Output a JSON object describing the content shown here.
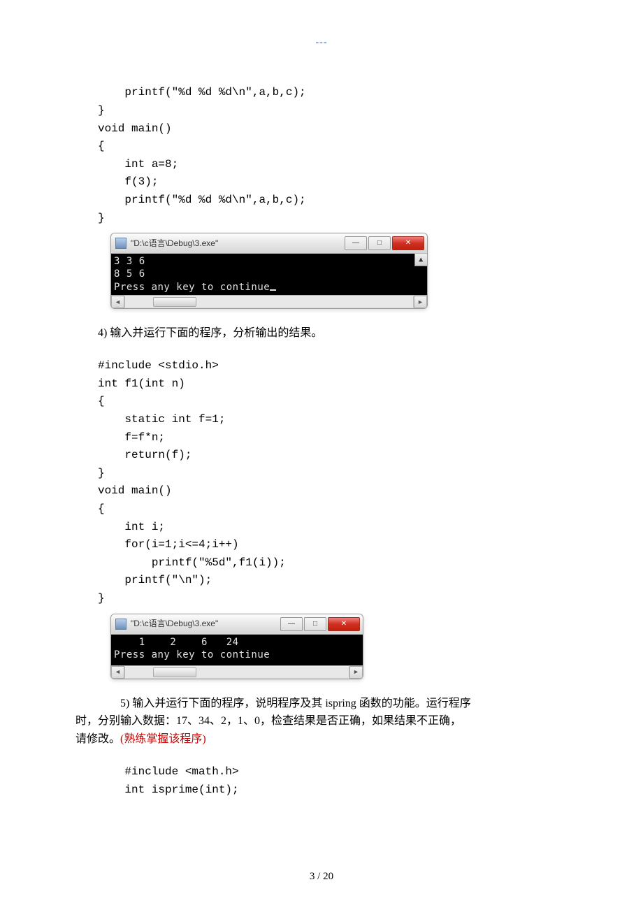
{
  "header_marks": "---",
  "code_block_1": "    printf(\"%d %d %d\\n\",a,b,c);\n}\nvoid main()\n{\n    int a=8;\n    f(3);\n    printf(\"%d %d %d\\n\",a,b,c);\n}",
  "console_1": {
    "title": "\"D:\\c语言\\Debug\\3.exe\"",
    "output": "3 3 6\n8 5 6\nPress any key to continue",
    "min_label": "—",
    "max_label": "□",
    "close_label": "✕",
    "arrow_up": "▲",
    "arrow_left": "◄",
    "arrow_right": "►"
  },
  "section_4": "4) 输入并运行下面的程序，分析输出的结果。",
  "code_block_2": "#include <stdio.h>\nint f1(int n)\n{\n    static int f=1;\n    f=f*n;\n    return(f);\n}\nvoid main()\n{\n    int i;\n    for(i=1;i<=4;i++)\n        printf(\"%5d\",f1(i));\n    printf(\"\\n\");\n}",
  "console_2": {
    "title": "\"D:\\c语言\\Debug\\3.exe\"",
    "output": "    1    2    6   24\nPress any key to continue",
    "min_label": "—",
    "max_label": "□",
    "close_label": "✕",
    "arrow_left": "◄",
    "arrow_right": "►"
  },
  "section_5_line1": "5) 输入并运行下面的程序，说明程序及其 ispring 函数的功能。运行程序",
  "section_5_line2": "时，分别输入数据：17、34、2，1、0，检查结果是否正确，如果结果不正确，",
  "section_5_line3_a": "请修改。",
  "section_5_line3_b": "(熟练掌握该程序)",
  "code_block_3": "    #include <math.h>\n    int isprime(int);",
  "page_number": "3 / 20"
}
